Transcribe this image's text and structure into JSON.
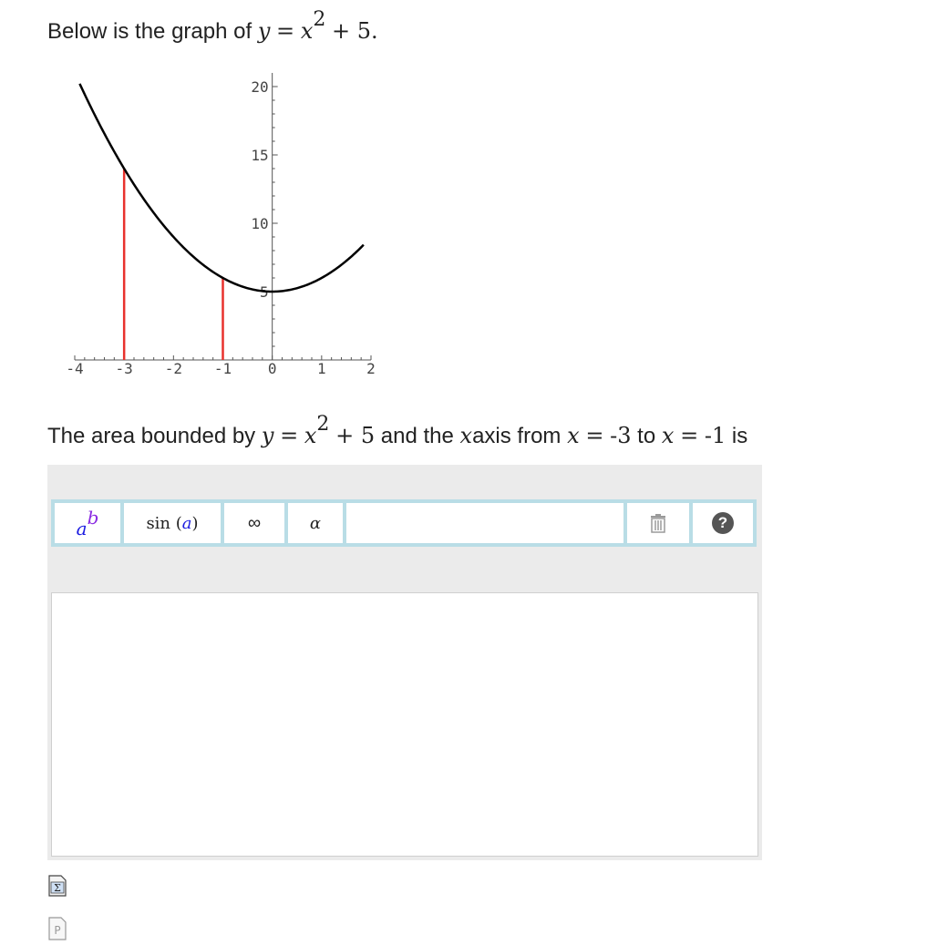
{
  "question": {
    "intro": "Below is the graph of",
    "eq_lhs": "y",
    "eq_op": "=",
    "eq_base": "x",
    "eq_exp": "2",
    "eq_tail": "+ 5."
  },
  "chart_data": {
    "type": "line",
    "function": "x^2 + 5",
    "xlim": [
      -4,
      2
    ],
    "ylim": [
      0,
      21
    ],
    "x_ticks": [
      "-4",
      "-3",
      "-2",
      "-1",
      "0",
      "1",
      "2"
    ],
    "y_ticks": [
      "5",
      "10",
      "15",
      "20"
    ],
    "vertical_lines": [
      {
        "x": -3,
        "y": 14,
        "color": "#e8322d"
      },
      {
        "x": -1,
        "y": 6,
        "color": "#e8322d"
      }
    ],
    "curve_color": "#000000"
  },
  "prompt": {
    "p1": "The area bounded by",
    "y": "y",
    "eq": "=",
    "x": "x",
    "exp": "2",
    "plus5": "+ 5",
    "p2": "and the",
    "xaxis_x": "x",
    "p3": "axis from",
    "x1": "x",
    "eq1": "=",
    "a": "-3",
    "p4": "to",
    "x2": "x",
    "eq2": "=",
    "b": "-1",
    "p5": "is"
  },
  "toolbar": {
    "power_base": "a",
    "power_exp": "b",
    "sin_label": "sin",
    "sin_arg": "a",
    "infinity_label": "∞",
    "alpha_label": "α",
    "help_label": "?"
  },
  "icons": {
    "sigma_icon": "Σ",
    "p_icon": "P"
  }
}
